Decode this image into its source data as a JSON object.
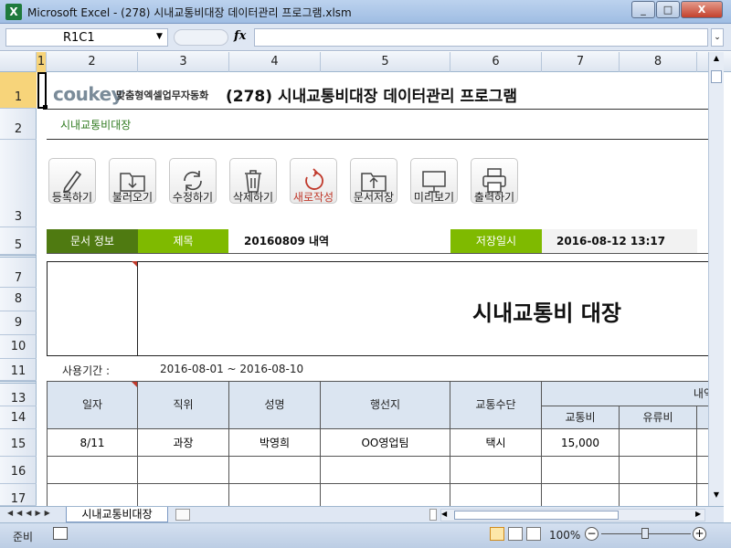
{
  "window": {
    "title": "Microsoft Excel - (278) 시내교통비대장 데이터관리 프로그램.xlsm",
    "app_icon": "X",
    "min": "_",
    "max": "□",
    "close": "X"
  },
  "formula_bar": {
    "name_box": "R1C1",
    "fx": "fx",
    "value": ""
  },
  "columns": [
    "1",
    "2",
    "3",
    "4",
    "5",
    "6",
    "7",
    "8"
  ],
  "rows": [
    "1",
    "2",
    "3",
    "5",
    "7",
    "8",
    "9",
    "10",
    "11",
    "13",
    "14",
    "15",
    "16",
    "17"
  ],
  "sheet": {
    "logo": "coukey",
    "logo_sub": "맞춤형엑셀업무자동화",
    "program_title": "(278) 시내교통비대장 데이터관리 프로그램",
    "sheet_heading": "시내교통비대장",
    "toolbar": [
      {
        "label": "등록하기",
        "icon": "pencil-icon"
      },
      {
        "label": "불러오기",
        "icon": "download-folder-icon"
      },
      {
        "label": "수정하기",
        "icon": "refresh-icon"
      },
      {
        "label": "삭제하기",
        "icon": "trash-icon"
      },
      {
        "label": "새로작성",
        "icon": "new-cycle-icon"
      },
      {
        "label": "문서저장",
        "icon": "upload-folder-icon"
      },
      {
        "label": "미리보기",
        "icon": "monitor-icon"
      },
      {
        "label": "출력하기",
        "icon": "printer-icon"
      }
    ],
    "info": {
      "doc_info_label": "문서 정보",
      "title_label": "제목",
      "title_value": "20160809 내역",
      "saved_label": "저장일시",
      "saved_value": "2016-08-12 13:17"
    },
    "ledger_title": "시내교통비 대장",
    "period_label": "사용기간 :",
    "period_value": "2016-08-01 ~ 2016-08-10",
    "table": {
      "headers": [
        "일자",
        "직위",
        "성명",
        "행선지",
        "교통수단",
        "내역"
      ],
      "sub_headers": [
        "교통비",
        "유류비"
      ],
      "rows": [
        [
          "8/11",
          "과장",
          "박영희",
          "OO영업팀",
          "택시",
          "15,000",
          ""
        ]
      ]
    }
  },
  "sheet_tab": "시내교통비대장",
  "status": {
    "mode": "준비",
    "zoom": "100%"
  },
  "colors": {
    "accent_green": "#7fba00",
    "dark_green": "#4f7a11",
    "header_blue": "#dbe5f1"
  }
}
